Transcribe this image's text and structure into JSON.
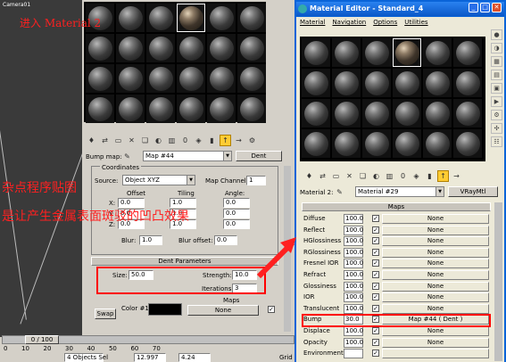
{
  "viewport": {
    "title": "Camera01"
  },
  "captions": {
    "enter_material": "进入 Material 2",
    "line1": "杂点程序贴图",
    "line2": "是让产生金属表面斑驳的凹凸效果"
  },
  "left_editor": {
    "bump_map_label": "Bump map:",
    "map_name": "Map #44",
    "map_type": "Dent",
    "coordinates_title": "Coordinates",
    "source_label": "Source:",
    "source_value": "Object XYZ",
    "map_channel_label": "Map Channel:",
    "map_channel_value": "1",
    "offset_label": "Offset",
    "tiling_label": "Tiling",
    "angle_label": "Angle:",
    "x_label": "X:",
    "y_label": "Y:",
    "z_label": "Z:",
    "offset_x": "0.0",
    "offset_y": "0.0",
    "offset_z": "0.0",
    "tiling_x": "1.0",
    "tiling_y": "1.0",
    "tiling_z": "1.0",
    "angle_x": "0.0",
    "angle_y": "0.0",
    "angle_z": "0.0",
    "blur_label": "Blur:",
    "blur_value": "1.0",
    "blur_offset_label": "Blur offset:",
    "blur_offset_value": "0.0",
    "dent_params_title": "Dent Parameters",
    "size_label": "Size:",
    "size_value": "50.0",
    "strength_label": "Strength:",
    "strength_value": "10.0",
    "iterations_label": "Iterations:",
    "iterations_value": "3",
    "maps_label": "Maps",
    "swap_label": "Swap",
    "color1_label": "Color #1",
    "none_label": "None"
  },
  "right_editor": {
    "title": "Material Editor - Standard_4",
    "menu": [
      "Material",
      "Navigation",
      "Options",
      "Utilities"
    ],
    "material_label": "Material 2:",
    "material_name": "Material #29",
    "material_type": "VRayMtl",
    "maps_title": "Maps",
    "rows": [
      {
        "name": "Diffuse",
        "value": "100.0",
        "map": "None"
      },
      {
        "name": "Reflect",
        "value": "100.0",
        "map": "None"
      },
      {
        "name": "HGlossiness",
        "value": "100.0",
        "map": "None"
      },
      {
        "name": "RGlossiness",
        "value": "100.0",
        "map": "None"
      },
      {
        "name": "Fresnel IOR",
        "value": "100.0",
        "map": "None"
      },
      {
        "name": "Refract",
        "value": "100.0",
        "map": "None"
      },
      {
        "name": "Glossiness",
        "value": "100.0",
        "map": "None"
      },
      {
        "name": "IOR",
        "value": "100.0",
        "map": "None"
      },
      {
        "name": "Translucent",
        "value": "100.0",
        "map": "None"
      },
      {
        "name": "Bump",
        "value": "30.0",
        "map": "Map #44  ( Dent )"
      },
      {
        "name": "Displace",
        "value": "100.0",
        "map": "None"
      },
      {
        "name": "Opacity",
        "value": "100.0",
        "map": "None"
      },
      {
        "name": "Environment",
        "value": "",
        "map": ""
      }
    ]
  },
  "bottom": {
    "frame": "0 / 100",
    "status": "4 Objects Sel",
    "x_value": "12.997",
    "y_value": "4.24",
    "grid_label": "Grid"
  },
  "colors": {
    "highlight": "#ff0000",
    "caption": "#ff2020",
    "panel": "#d4d0c8",
    "xp_blue": "#0a64d8"
  }
}
